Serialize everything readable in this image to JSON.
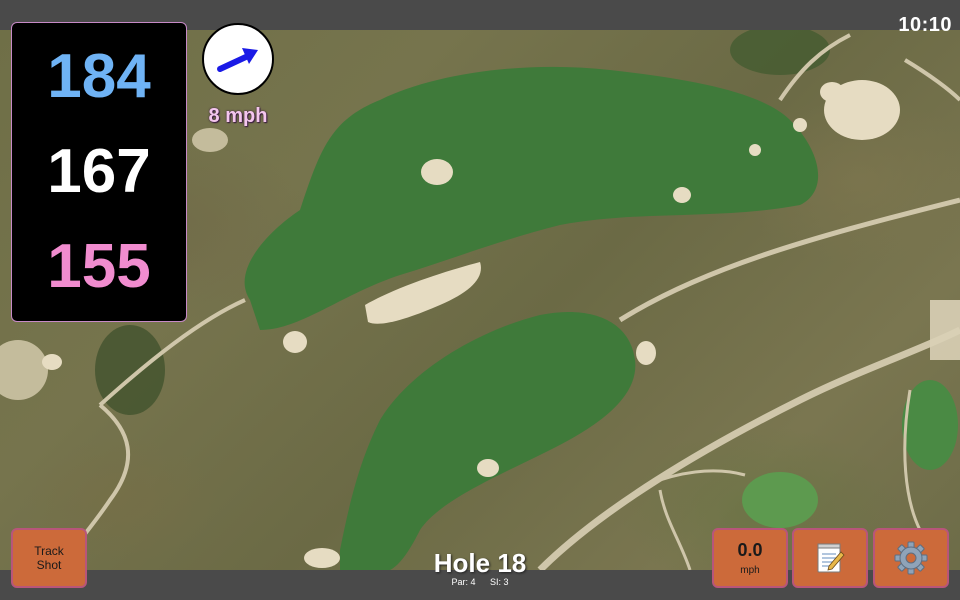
{
  "status": {
    "time": "10:10"
  },
  "distances": {
    "back": "184",
    "middle": "167",
    "front": "155"
  },
  "wind": {
    "speed": "8 mph",
    "icon": "wind-direction-arrow-icon"
  },
  "buttons": {
    "track_shot": {
      "line1": "Track",
      "line2": "Shot"
    },
    "speed": {
      "value": "0.0",
      "unit": "mph"
    },
    "notes": {
      "icon": "notepad-icon"
    },
    "settings": {
      "icon": "gear-icon"
    }
  },
  "hole": {
    "title": "Hole 18",
    "par": "Par: 4",
    "si": "SI: 3"
  },
  "colors": {
    "back": "#6fb3f5",
    "middle": "#ffffff",
    "front": "#f18ccf",
    "button": "#cc6a3a",
    "wind_arrow": "#1a1ae6"
  }
}
